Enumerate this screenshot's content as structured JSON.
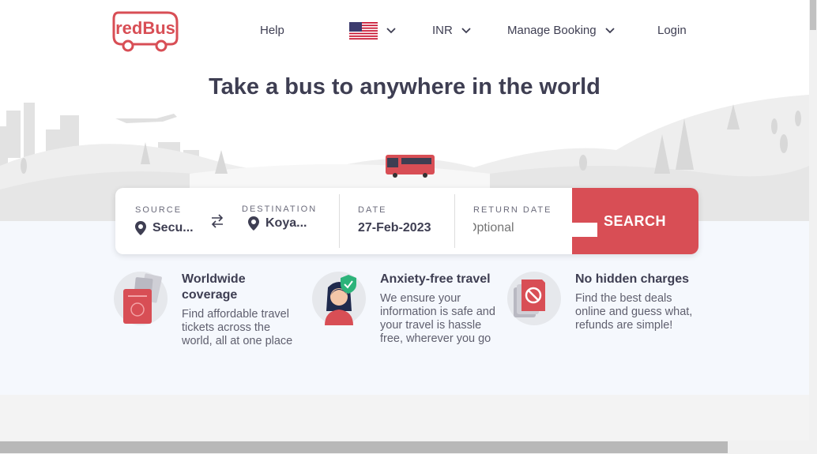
{
  "header": {
    "brand": "redBus",
    "nav": {
      "help": "Help",
      "currency": "INR",
      "manage_booking": "Manage Booking",
      "login": "Login"
    }
  },
  "hero": {
    "title": "Take a bus to anywhere in the world"
  },
  "search": {
    "source_label": "SOURCE",
    "source_value": "Secu...",
    "destination_label": "DESTINATION",
    "destination_value": "Koya...",
    "date_label": "DATE",
    "date_value": "27-Feb-2023",
    "return_label": "RETURN DATE",
    "return_placeholder": "Optional",
    "search_label": "SEARCH"
  },
  "features": [
    {
      "title": "Worldwide coverage",
      "desc": "Find affordable travel tickets across the world, all at one place"
    },
    {
      "title": "Anxiety-free travel",
      "desc": "We ensure your information is safe and your travel is hassle free, wherever you go"
    },
    {
      "title": "No hidden charges",
      "desc": "Find the best deals online and guess what, refunds are simple!"
    }
  ],
  "colors": {
    "brand": "#d84e55",
    "text": "#3e3e52",
    "band": "#f5f8fd"
  }
}
